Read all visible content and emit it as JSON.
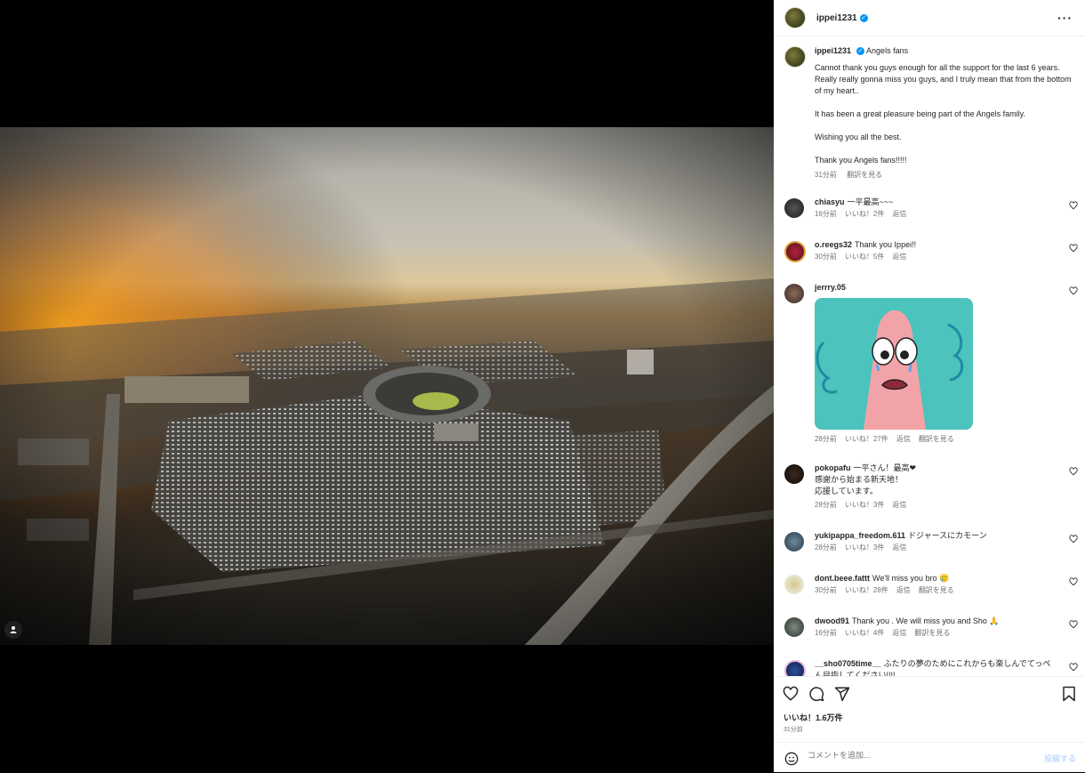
{
  "post": {
    "username": "ippei1231",
    "caption_title": "Angels fans",
    "caption_lines": [
      "Cannot thank you guys enough for all the support for the last 6 years. Really really gonna miss you guys, and I truly mean that from the bottom of my heart..",
      "It has been a great pleasure being part of the Angels family.",
      "Wishing you all the best.",
      "Thank you Angels fans!!!!!"
    ],
    "caption_time": "31分前",
    "see_translation": "翻訳を見る"
  },
  "comments": [
    {
      "user": "chiasyu",
      "text": "一平最高~~~",
      "time": "16分前",
      "likes": "いいね！2件",
      "reply": "返信"
    },
    {
      "user": "o.reegs32",
      "text": "Thank you Ippei!!",
      "time": "30分前",
      "likes": "いいね！5件",
      "reply": "返信"
    },
    {
      "user": "jerrry.05",
      "text": "",
      "time": "28分前",
      "likes": "いいね！27件",
      "reply": "返信",
      "translate": "翻訳を見る"
    },
    {
      "user": "pokopafu",
      "text": "一平さん！最高❤",
      "text2": "感謝から始まる新天地！",
      "text3": "応援しています。",
      "time": "28分前",
      "likes": "いいね！3件",
      "reply": "返信"
    },
    {
      "user": "yukipappa_freedom.611",
      "text": "ドジャースにカモーン",
      "time": "28分前",
      "likes": "いいね！3件",
      "reply": "返信"
    },
    {
      "user": "dont.beee.fattt",
      "text": "We'll miss you bro 🥲",
      "time": "30分前",
      "likes": "いいね！28件",
      "reply": "返信",
      "translate": "翻訳を見る"
    },
    {
      "user": "dwood91",
      "text": "Thank you . We will miss you and Sho 🙏",
      "time": "16分前",
      "likes": "いいね！4件",
      "reply": "返信",
      "translate": "翻訳を見る"
    },
    {
      "user": "__sho0705time__",
      "text": "ふたりの夢のためにこれからも楽しんでてっぺん目指してください!!!!",
      "time": "",
      "likes": "",
      "reply": ""
    }
  ],
  "footer": {
    "likes_count": "いいね！1.6万件",
    "time": "31分前",
    "comment_placeholder": "コメントを追加...",
    "post_button": "投稿する"
  },
  "icons": {
    "more": "more-options-icon",
    "like": "heart-icon",
    "comment": "comment-icon",
    "share": "share-icon",
    "save": "bookmark-icon",
    "emoji": "emoji-icon",
    "user_tag": "user-tag-icon"
  },
  "colors": {
    "verified": "#0095f6",
    "muted": "#737373",
    "post_disabled": "#c0dffd"
  }
}
